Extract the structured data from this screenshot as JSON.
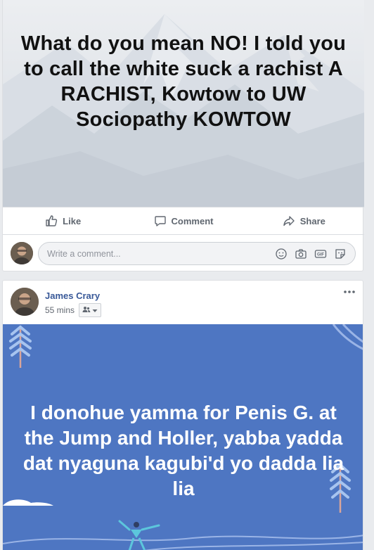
{
  "post1": {
    "text": "What do you mean NO! I told you to call the white suck a rachist A RACHIST, Kowtow to UW Sociopathy KOWTOW",
    "actions": {
      "like": "Like",
      "comment": "Comment",
      "share": "Share"
    },
    "comment_placeholder": "Write a comment..."
  },
  "post2": {
    "author": "James Crary",
    "time": "55 mins",
    "text": "I donohue yamma for Penis G. at the Jump and Holler, yabba yadda dat nyaguna kagubi'd yo dadda lia lia"
  },
  "colors": {
    "facebook_blue_link": "#385898",
    "post_background_blue": "#4e76c2",
    "action_gray": "#606770"
  }
}
